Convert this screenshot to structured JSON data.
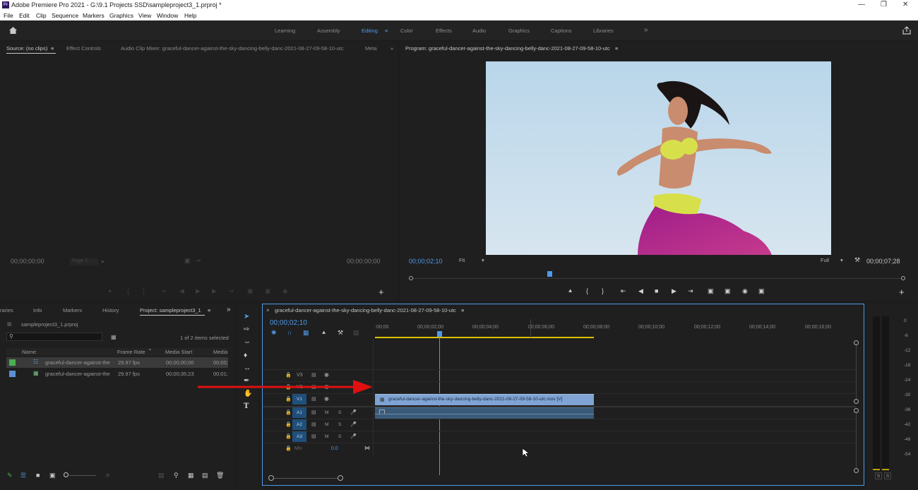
{
  "window": {
    "title": "Adobe Premiere Pro 2021 - G:\\9.1 Projects SSD\\sampleproject3_1.prproj *",
    "app_icon": "Pr"
  },
  "menu": [
    "File",
    "Edit",
    "Clip",
    "Sequence",
    "Markers",
    "Graphics",
    "View",
    "Window",
    "Help"
  ],
  "workspaces": [
    "Learning",
    "Assembly",
    "Editing",
    "Color",
    "Effects",
    "Audio",
    "Graphics",
    "Captions",
    "Libraries"
  ],
  "active_workspace": "Editing",
  "source_panel": {
    "tabs": [
      "Source: (no clips)",
      "Effect Controls",
      "Audio Clip Mixer: graceful-dancer-against-the-sky-dancing-belly-danc-2021-08-27-09-58-10-utc",
      "Meta"
    ],
    "timecode_left": "00;00;00;00",
    "timecode_right": "00;00;00;00",
    "page": "Page 1"
  },
  "program_panel": {
    "title": "Program: graceful-dancer-against-the-sky-dancing-belly-danc-2021-08-27-09-58-10-utc",
    "timecode": "00;00;02;10",
    "zoom": "Fit",
    "quality": "Full",
    "duration": "00;00;07;28",
    "playhead_fraction": 0.28
  },
  "project_panel": {
    "tabs": [
      "raries",
      "Info",
      "Markers",
      "History",
      "Project: sampleproject3_1"
    ],
    "project_file": "sampleproject3_1.prproj",
    "selection_info": "1 of 2 items selected",
    "columns": [
      "Name",
      "Frame Rate",
      "Media Start",
      "Media"
    ],
    "items": [
      {
        "color": "#4caf50",
        "name": "graceful-dancer-against-the",
        "frame_rate": "29.97 fps",
        "media_start": "00;00;00;00",
        "media": "00;00;",
        "selected": true
      },
      {
        "color": "#5b8fd6",
        "name": "graceful-dancer-against-the",
        "frame_rate": "29.97 fps",
        "media_start": "00;00;35;23",
        "media": "00;01;",
        "selected": false
      }
    ]
  },
  "timeline": {
    "sequence_name": "graceful-dancer-against-the-sky-dancing-belly-danc-2021-08-27-09-58-10-utc",
    "timecode": "00;00;02;10",
    "ruler": [
      ":00;00",
      "00;00;02;00",
      "00;00;04;00",
      "00;00;06;00",
      "00;00;08;00",
      "00;00;10;00",
      "00;00;12;00",
      "00;00;14;00",
      "00;00;16;00"
    ],
    "video_tracks": [
      "V3",
      "V2",
      "V1"
    ],
    "audio_tracks": [
      "A1",
      "A2",
      "A3"
    ],
    "mix_label": "Mix",
    "mix_value": "0.0",
    "clip_label": "graceful-dancer-against-the-sky-dancing-belly-danc-2021-08-27-09-58-10-utc.mov [V]",
    "m_label": "M",
    "s_label": "S"
  },
  "meters": {
    "scale": [
      "0",
      "-6",
      "-12",
      "-18",
      "-24",
      "-30",
      "-36",
      "-42",
      "-48",
      "-54"
    ],
    "s_labels": [
      "S",
      "S"
    ]
  },
  "colors": {
    "accent": "#4e9ae8",
    "clip_video": "#7ea3d4",
    "clip_audio": "#3a5a7a",
    "arrow": "#e01010"
  }
}
